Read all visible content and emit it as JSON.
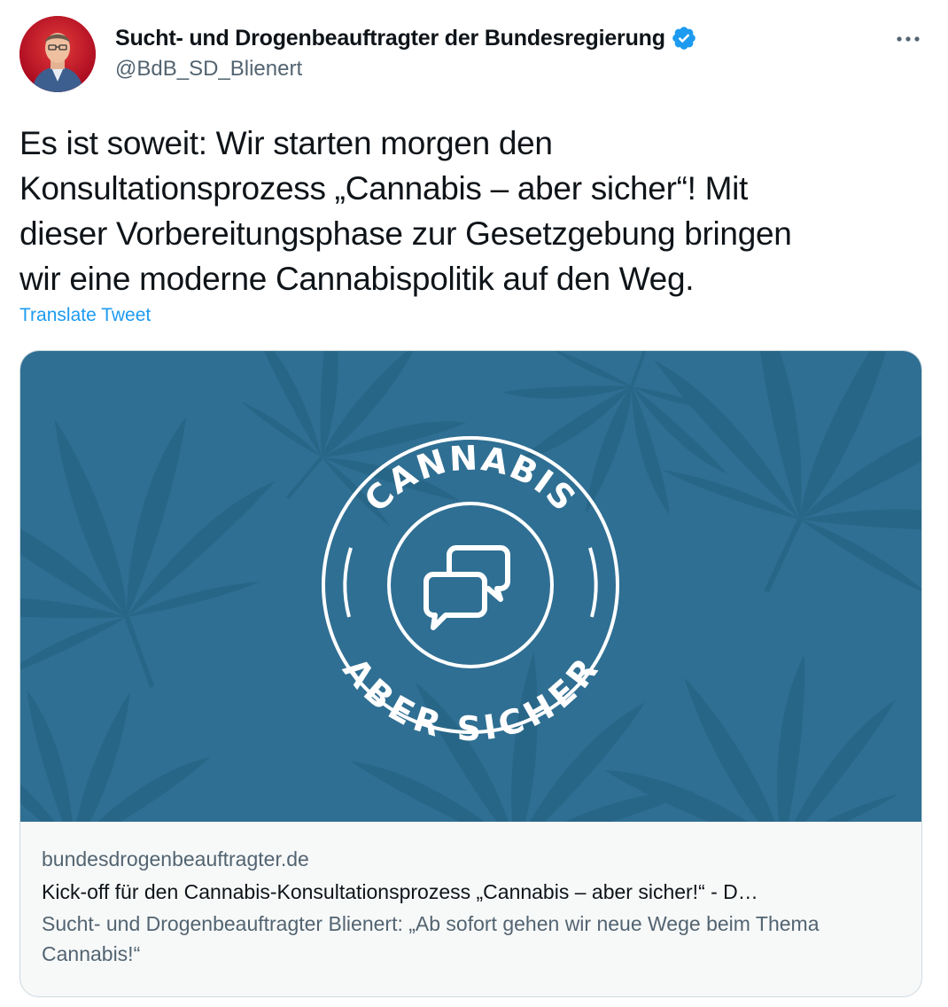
{
  "author": {
    "display_name": "Sucht- und Drogenbeauftragter der Bundesregierung",
    "handle": "@BdB_SD_Blienert",
    "verified": true,
    "verified_color": "#1d9bf0",
    "avatar_icon": "profile-photo"
  },
  "tweet": {
    "text": "Es ist soweit: Wir starten morgen den\nKonsultationsprozess „Cannabis – aber sicher“! Mit\ndieser Vorbereitungsphase zur Gesetzgebung bringen\nwir eine moderne Cannabispolitik auf den Weg.",
    "translate_label": "Translate Tweet",
    "more_icon": "more-horizontal-icon"
  },
  "card": {
    "image_background": "#2f6f93",
    "logo_top_text": "CANNABIS",
    "logo_bottom_text": "ABER SICHER",
    "domain": "bundesdrogenbeauftragter.de",
    "title": "Kick-off für den Cannabis-Konsultationsprozess „Cannabis – aber sicher!“ - D…",
    "description": "Sucht- und Drogenbeauftragter Blienert: „Ab sofort gehen wir neue Wege beim Thema Cannabis!“"
  },
  "colors": {
    "link": "#1d9bf0",
    "secondary_text": "#536471",
    "primary_text": "#0f1419",
    "card_border": "#cfd9de"
  }
}
